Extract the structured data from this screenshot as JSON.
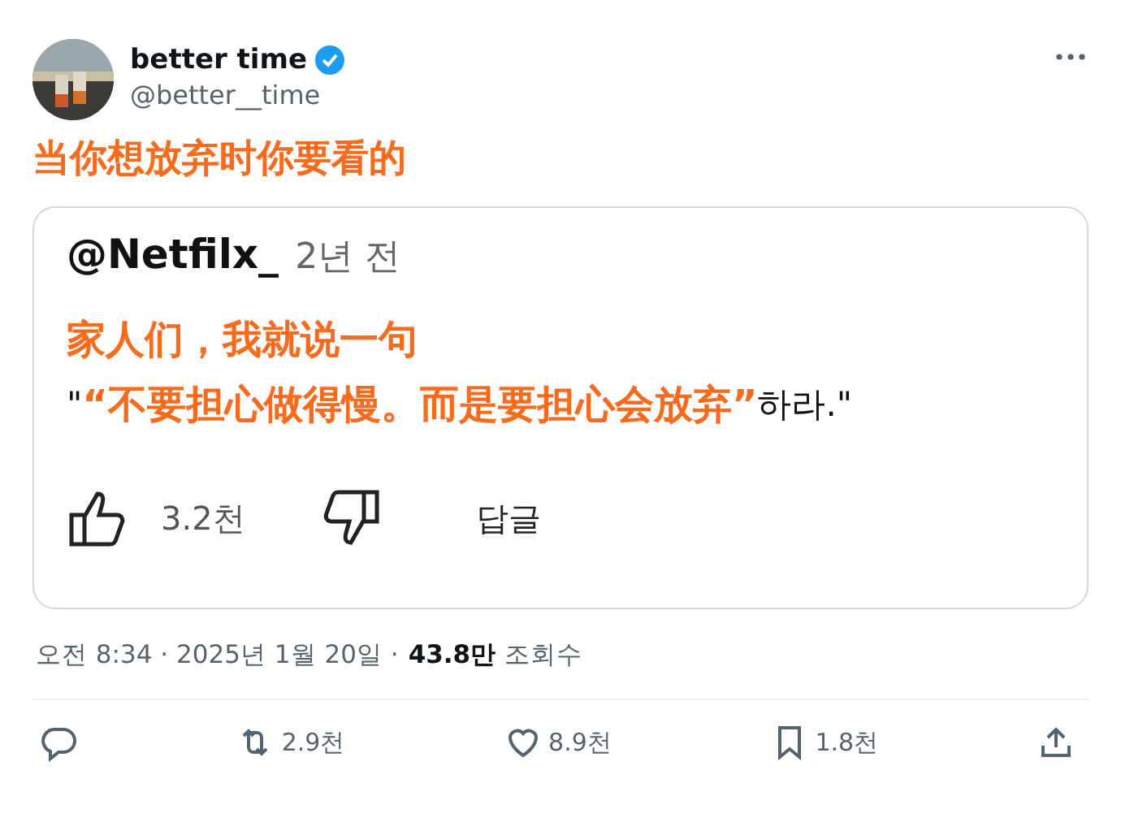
{
  "author": {
    "name": "better time",
    "verified": true,
    "handle": "@better__time"
  },
  "text": "当你想放弃时你要看的",
  "media": {
    "comment": {
      "user": "@Netfilx_",
      "time": "2년 전",
      "overlay_line_1": "家人们，我就说一句",
      "quote_open": "\"",
      "overlay_line_2": "“不要担心做得慢。而是要担心会放弃”",
      "quote_end": "하라.\"",
      "likes": "3.2천",
      "reply": "답글"
    }
  },
  "meta": {
    "time": "오전 8:34",
    "separator": "·",
    "date": "2025년 1월 20일",
    "views": "43.8만",
    "views_label": "조회수"
  },
  "actions": [
    {
      "kind": "reply"
    },
    {
      "kind": "repost",
      "count": "2.9천"
    },
    {
      "kind": "like",
      "count": "8.9천"
    },
    {
      "kind": "bookmark",
      "count": "1.8천"
    },
    {
      "kind": "share"
    }
  ]
}
